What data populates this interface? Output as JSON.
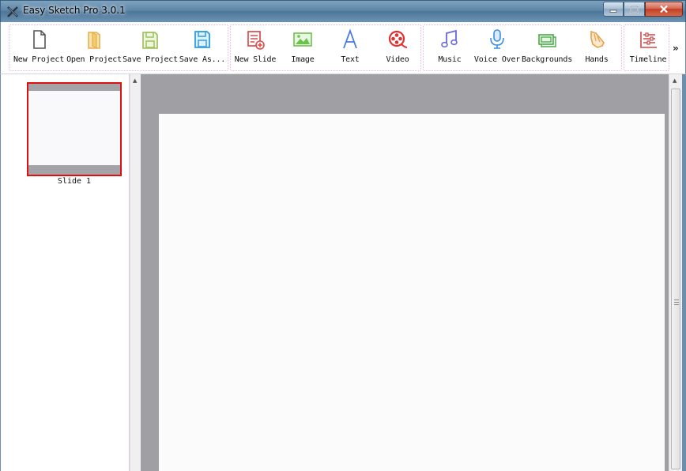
{
  "window": {
    "title": "Easy Sketch Pro 3.0.1",
    "controls": [
      "minimize-icon",
      "maximize-icon",
      "close-icon"
    ]
  },
  "toolbar": {
    "buttons": [
      {
        "label": "New Project",
        "icon": "new-file-icon",
        "color": "#555555"
      },
      {
        "label": "Open Project",
        "icon": "open-folder-icon",
        "color": "#e6b04a"
      },
      {
        "label": "Save Project",
        "icon": "save-disk-icon",
        "color": "#9bbd5a"
      },
      {
        "label": "Save As...",
        "icon": "save-as-disk-icon",
        "color": "#2e9fe0"
      },
      {
        "label": "New Slide",
        "icon": "new-slide-icon",
        "color": "#e04a4a"
      },
      {
        "label": "Image",
        "icon": "image-icon",
        "color": "#6bc24a"
      },
      {
        "label": "Text",
        "icon": "text-icon",
        "color": "#4a7ae0"
      },
      {
        "label": "Video",
        "icon": "video-icon",
        "color": "#e03030"
      },
      {
        "label": "Music",
        "icon": "music-icon",
        "color": "#6a6ae0"
      },
      {
        "label": "Voice Over",
        "icon": "microphone-icon",
        "color": "#3a8fe0"
      },
      {
        "label": "Backgrounds",
        "icon": "backgrounds-icon",
        "color": "#4aa84a"
      },
      {
        "label": "Hands",
        "icon": "hand-icon",
        "color": "#e6a04a"
      },
      {
        "label": "Timeline",
        "icon": "timeline-icon",
        "color": "#d04848"
      }
    ],
    "overflow": "»"
  },
  "slides": [
    {
      "label": "Slide 1",
      "selected": true
    }
  ],
  "colors": {
    "selection_border": "#e01010",
    "canvas_bg": "#a09fa4",
    "page_bg": "#fbfbfc"
  }
}
